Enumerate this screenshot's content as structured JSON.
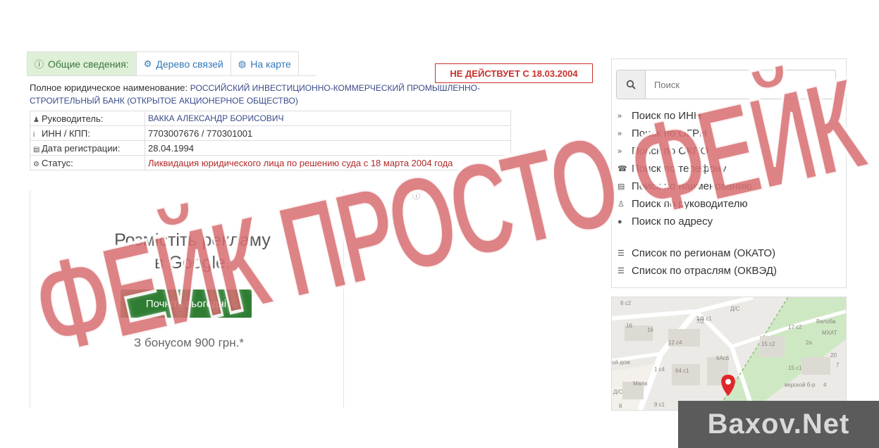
{
  "tabs": [
    {
      "icon": "info-circle-icon",
      "label": "Общие сведения:"
    },
    {
      "icon": "cogs-icon",
      "label": "Дерево связей"
    },
    {
      "icon": "globe-icon",
      "label": "На карте"
    }
  ],
  "status_stamp": "НЕ ДЕЙСТВУЕТ С 18.03.2004",
  "full_name": {
    "label": "Полное юридическое наименование:",
    "value": "РОССИЙСКИЙ ИНВЕСТИЦИОННО-КОММЕРЧЕСКИЙ ПРОМЫШЛЕННО-СТРОИТЕЛЬНЫЙ БАНК (ОТКРЫТОЕ АКЦИОНЕРНОЕ ОБЩЕСТВО)"
  },
  "info_rows": [
    {
      "icon": "user-icon",
      "key": "Руководитель:",
      "value": "ВАККА АЛЕКСАНДР БОРИСОВИЧ"
    },
    {
      "icon": "info-icon",
      "key": "ИНН / КПП:",
      "value": "7703007676 / 770301001"
    },
    {
      "icon": "calendar-icon",
      "key": "Дата регистрации:",
      "value": "28.04.1994"
    },
    {
      "icon": "cogs-icon",
      "key": "Статус:",
      "value": "Ликвидация юридического лица по решению суда с 18 марта 2004 года"
    }
  ],
  "ad": {
    "line1": "Розмістіть рекламу",
    "line2": "в Google.",
    "button": "Почніть сьогодні",
    "footer": "З бонусом 900 грн.*",
    "info": "ⓘ"
  },
  "search": {
    "placeholder": "Поиск",
    "links": [
      {
        "icon": "chevron-right-icon",
        "label": "Поиск по ИНН"
      },
      {
        "icon": "chevron-right-icon",
        "label": "Поиск по ОГРН"
      },
      {
        "icon": "chevron-right-icon",
        "label": "Поиск по ОКПО"
      },
      {
        "icon": "phone-icon",
        "label": "Поиск по телефону"
      },
      {
        "icon": "document-icon",
        "label": "Поиск по наименованию"
      },
      {
        "icon": "user-outline-icon",
        "label": "Поиск по руководителю"
      },
      {
        "icon": "map-marker-icon",
        "label": "Поиск по адресу"
      }
    ],
    "lists": [
      {
        "icon": "list-icon",
        "label": "Список по регионам (ОКАТО)"
      },
      {
        "icon": "list-icon",
        "label": "Список по отраслям (ОКВЭД)"
      }
    ]
  },
  "map": {
    "labels": [
      "8 с2",
      "Д/С",
      "7/2",
      "16",
      "1/8 с1",
      "16",
      "12 с4",
      "17 с2",
      "Велоба",
      "МХАТ",
      "ой дом",
      "1 с4",
      "15 с2",
      "6Ас6",
      "64 с1",
      "Мала",
      "Д/С",
      "15 с1",
      "20",
      "7",
      "2а",
      "8",
      "9 с1",
      "4",
      "верской б-р"
    ]
  },
  "watermark": "ФЕЙК ПРОСТО ФЕЙК",
  "site_mark": "Baxov.Net",
  "colors": {
    "active_tab_bg": "#dff0d8",
    "status_red": "#c9302c",
    "ad_button": "#2e7d32",
    "watermark": "#c8373c"
  }
}
